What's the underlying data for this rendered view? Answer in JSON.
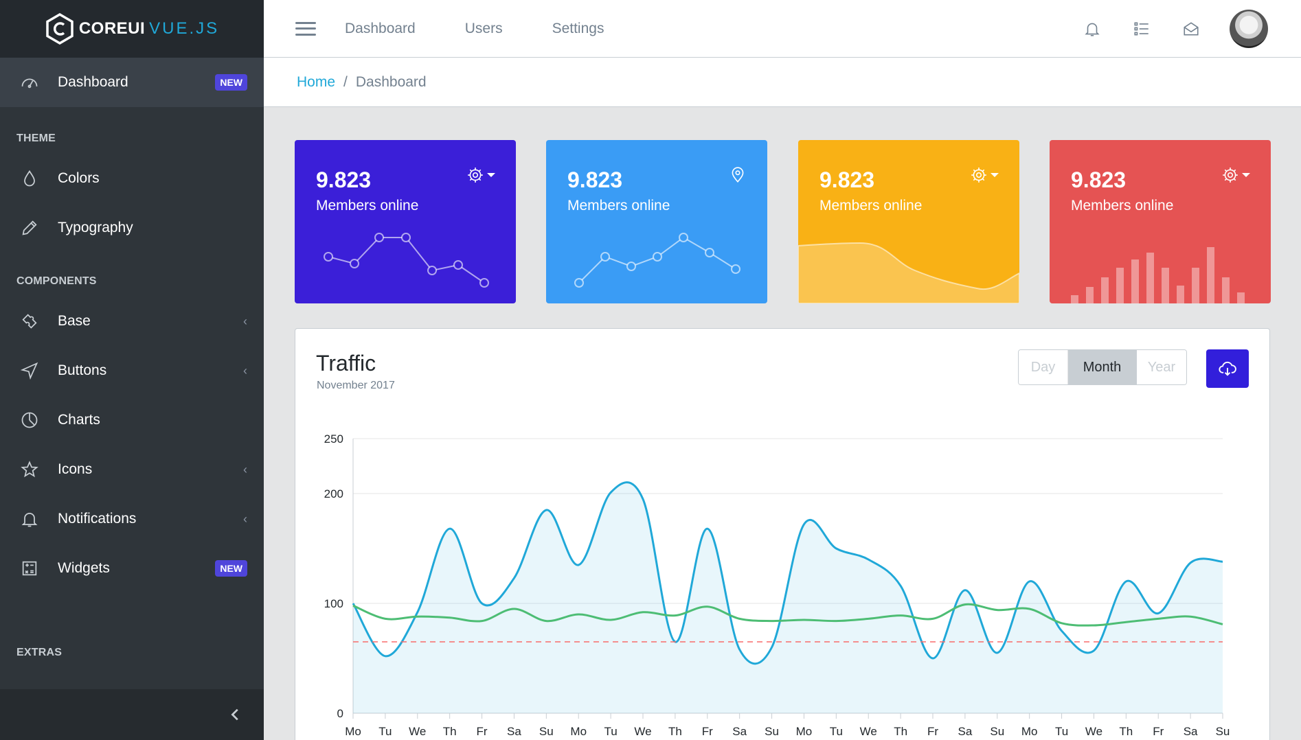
{
  "brand": {
    "name_bold": "COREUI",
    "name_light": "VUE.JS"
  },
  "sidebar": {
    "active": {
      "label": "Dashboard",
      "badge": "NEW"
    },
    "sections": [
      {
        "title": "THEME",
        "items": [
          {
            "label": "Colors",
            "icon": "drop-icon"
          },
          {
            "label": "Typography",
            "icon": "pencil-icon"
          }
        ]
      },
      {
        "title": "COMPONENTS",
        "items": [
          {
            "label": "Base",
            "icon": "puzzle-icon",
            "chevron": "‹"
          },
          {
            "label": "Buttons",
            "icon": "cursor-icon",
            "chevron": "‹"
          },
          {
            "label": "Charts",
            "icon": "pie-chart-icon"
          },
          {
            "label": "Icons",
            "icon": "star-icon",
            "chevron": "‹"
          },
          {
            "label": "Notifications",
            "icon": "bell-icon",
            "chevron": "‹"
          },
          {
            "label": "Widgets",
            "icon": "calculator-icon",
            "badge": "NEW"
          }
        ]
      },
      {
        "title": "EXTRAS",
        "items": []
      }
    ]
  },
  "header": {
    "nav": [
      "Dashboard",
      "Users",
      "Settings"
    ]
  },
  "breadcrumb": {
    "home": "Home",
    "separator": "/",
    "current": "Dashboard"
  },
  "cards": [
    {
      "value": "9.823",
      "label": "Members online",
      "color": "#3b1fd8",
      "icon": "gear-icon",
      "dropdown": true
    },
    {
      "value": "9.823",
      "label": "Members online",
      "color": "#3a9cf5",
      "icon": "location-pin-icon",
      "dropdown": false
    },
    {
      "value": "9.823",
      "label": "Members online",
      "color": "#f9b115",
      "icon": "gear-icon",
      "dropdown": true
    },
    {
      "value": "9.823",
      "label": "Members online",
      "color": "#e55353",
      "icon": "gear-icon",
      "dropdown": true
    }
  ],
  "traffic": {
    "title": "Traffic",
    "subtitle": "November 2017",
    "periods": [
      "Day",
      "Month",
      "Year"
    ],
    "active_period": "Month"
  },
  "chart_data": {
    "type": "line",
    "x": [
      "Mo",
      "Tu",
      "We",
      "Th",
      "Fr",
      "Sa",
      "Su",
      "Mo",
      "Tu",
      "We",
      "Th",
      "Fr",
      "Sa",
      "Su",
      "Mo",
      "Tu",
      "We",
      "Th",
      "Fr",
      "Sa",
      "Su",
      "Mo",
      "Tu",
      "We",
      "Th",
      "Fr",
      "Sa",
      "Su"
    ],
    "ylim": [
      0,
      250
    ],
    "yticks": [
      0,
      100,
      200,
      250
    ],
    "grid": true,
    "series": [
      {
        "values": [
          100,
          52,
          92,
          168,
          100,
          123,
          185,
          135,
          201,
          195,
          65,
          168,
          58,
          60,
          172,
          150,
          140,
          116,
          50,
          112,
          55,
          120,
          75,
          57,
          120,
          91,
          137,
          138
        ],
        "color": "#20a8d8",
        "fill": true
      },
      {
        "values": [
          98,
          86,
          88,
          87,
          84,
          95,
          84,
          90,
          85,
          92,
          89,
          97,
          86,
          84,
          85,
          84,
          86,
          89,
          86,
          99,
          94,
          95,
          82,
          80,
          83,
          86,
          88,
          81
        ],
        "color": "#4dbd74",
        "fill": false
      },
      {
        "values": [
          65,
          65,
          65,
          65,
          65,
          65,
          65,
          65,
          65,
          65,
          65,
          65,
          65,
          65,
          65,
          65,
          65,
          65,
          65,
          65,
          65,
          65,
          65,
          65,
          65,
          65,
          65,
          65
        ],
        "color": "#f86c6b",
        "dashed": true
      }
    ]
  }
}
